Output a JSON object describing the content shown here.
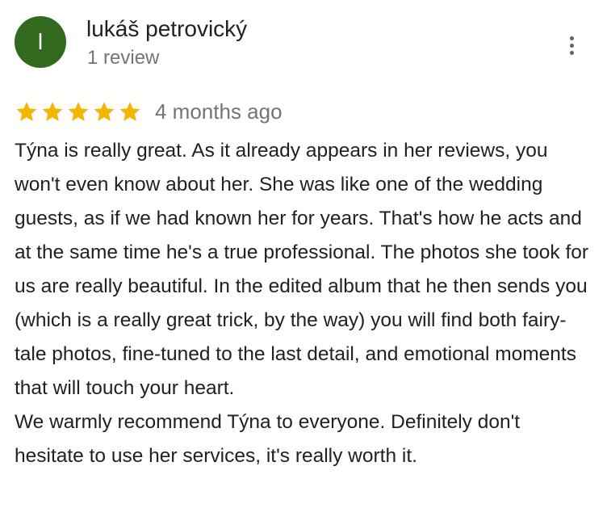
{
  "review": {
    "author": {
      "initial": "l",
      "name": "lukáš petrovický",
      "review_count": "1 review",
      "avatar_color": "#33691e"
    },
    "menu_icon": "more-vert-icon",
    "rating": {
      "stars": 5,
      "max_stars": 5,
      "star_color": "#f4b400",
      "date": "4 months ago"
    },
    "text": {
      "paragraph_1": "Týna is really great. As it already appears in her reviews, you won't even know about her. She was like one of the wedding guests, as if we had known her for years. That's how he acts and at the same time he's a true professional. The photos she took for us are really beautiful. In the edited album that he then sends you (which is a really great trick, by the way) you will find both fairy-tale photos, fine-tuned to the last detail, and emotional moments that will touch your heart.",
      "paragraph_2": "We warmly recommend Týna to everyone. Definitely don't hesitate to use her services, it's really worth it."
    }
  }
}
